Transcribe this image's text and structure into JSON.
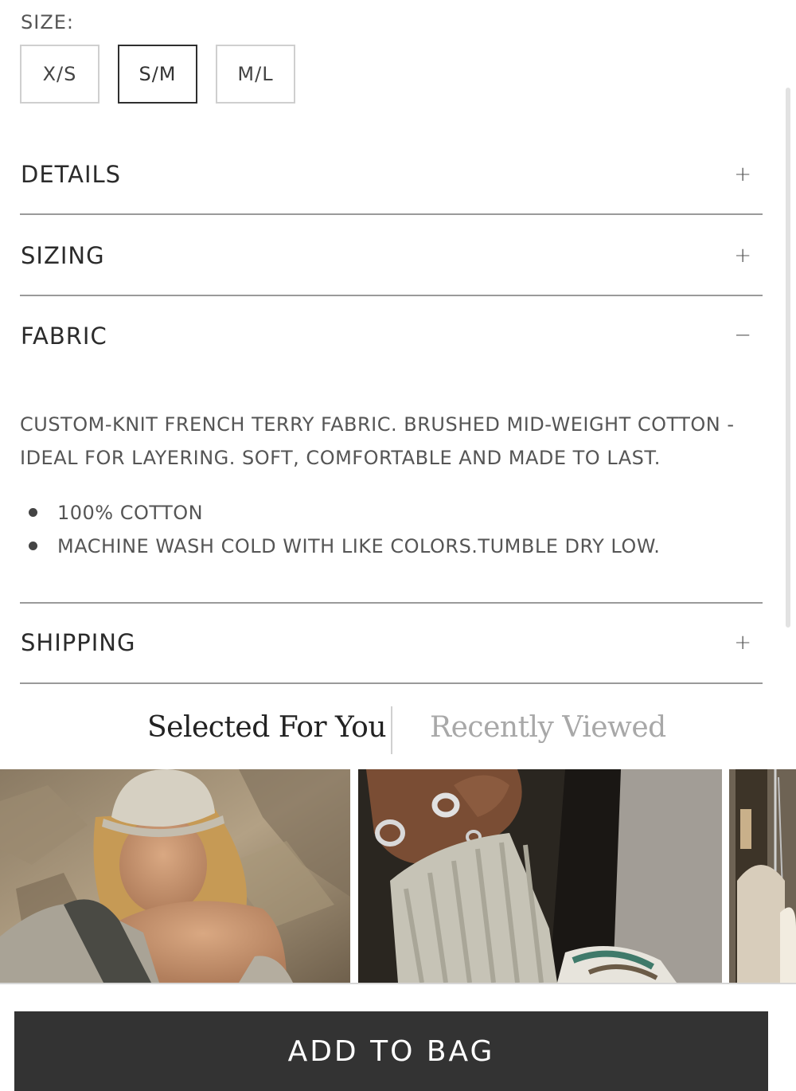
{
  "size": {
    "label": "SIZE:",
    "options": [
      "X/S",
      "S/M",
      "M/L"
    ],
    "selected": "S/M"
  },
  "accordion": {
    "details": {
      "title": "DETAILS",
      "icon": "+"
    },
    "sizing": {
      "title": "SIZING",
      "icon": "+"
    },
    "fabric": {
      "title": "FABRIC",
      "icon": "−",
      "description_line1": "CUSTOM-KNIT FRENCH TERRY FABRIC. BRUSHED MID-WEIGHT COTTON -",
      "description_line2": "IDEAL FOR LAYERING. SOFT, COMFORTABLE AND MADE TO LAST.",
      "bullets": [
        "100% COTTON",
        "MACHINE WASH COLD WITH LIKE COLORS.TUMBLE DRY LOW."
      ]
    },
    "shipping": {
      "title": "SHIPPING",
      "icon": "+"
    }
  },
  "recommendations": {
    "tabs": [
      {
        "label": "Selected For You",
        "active": true
      },
      {
        "label": "Recently Viewed",
        "active": false
      }
    ]
  },
  "cta": {
    "add_to_bag": "ADD TO BAG"
  },
  "colors": {
    "accent": "#333333",
    "border": "#cfcfcf",
    "text": "#2b2b2b",
    "muted": "#a8a8a8"
  }
}
